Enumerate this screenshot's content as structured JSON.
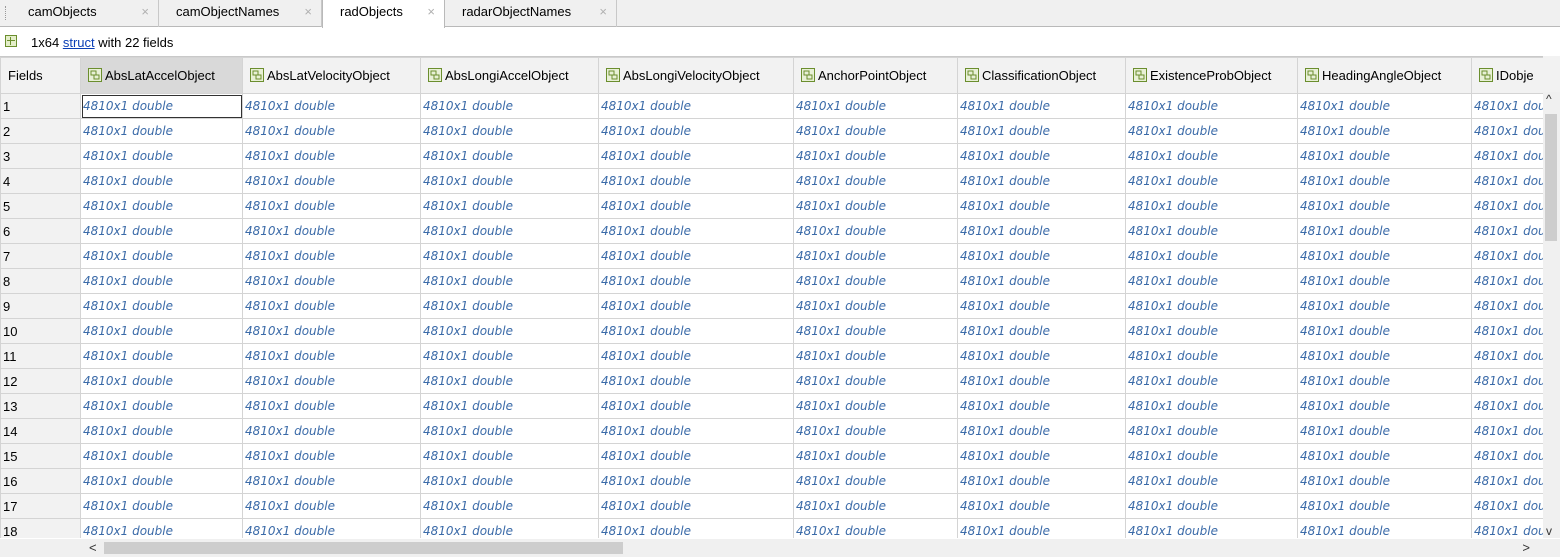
{
  "tabs": [
    {
      "label": "camObjects",
      "close": "×"
    },
    {
      "label": "camObjectNames",
      "close": "×"
    },
    {
      "label": "radObjects",
      "close": "×"
    },
    {
      "label": "radarObjectNames",
      "close": "×"
    }
  ],
  "active_tab": "radObjects",
  "info": {
    "size": "1x64",
    "link": "struct",
    "suffix": "with 22 fields",
    "icon": "struct-icon"
  },
  "grid": {
    "corner_header": "Fields",
    "columns": [
      "AbsLatAccelObject",
      "AbsLatVelocityObject",
      "AbsLongiAccelObject",
      "AbsLongiVelocityObject",
      "AnchorPointObject",
      "ClassificationObject",
      "ExistenceProbObject",
      "HeadingAngleObject",
      "IDobje"
    ],
    "selected_column": "AbsLatAccelObject",
    "rows": [
      "1",
      "2",
      "3",
      "4",
      "5",
      "6",
      "7",
      "8",
      "9",
      "10",
      "11",
      "12",
      "13",
      "14",
      "15",
      "16",
      "17",
      "18"
    ],
    "cell_value": "4810x1 double",
    "field_icon": "struct-field-icon"
  },
  "scrollbars": {
    "up": "^",
    "down": "v",
    "left": "<",
    "right": ">"
  },
  "colors": {
    "cell_text": "#3a6aa8",
    "link": "#0b3fb6",
    "header_bg": "#f2f2f2",
    "selected_header_bg": "#d9d9d9"
  }
}
